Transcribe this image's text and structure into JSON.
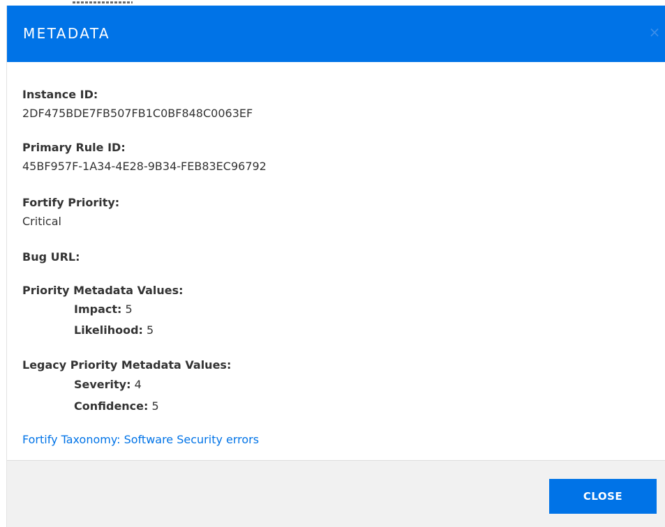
{
  "dialog": {
    "title": "METADATA",
    "close_icon": "close-icon",
    "close_glyph": "×"
  },
  "fields": {
    "instance_id": {
      "label": "Instance ID:",
      "value": "2DF475BDE7FB507FB1C0BF848C0063EF"
    },
    "primary_rule_id": {
      "label": "Primary Rule ID:",
      "value": "45BF957F-1A34-4E28-9B34-FEB83EC96792"
    },
    "fortify_priority": {
      "label": "Fortify Priority:",
      "value": "Critical"
    },
    "bug_url": {
      "label": "Bug URL:",
      "value": ""
    },
    "priority_metadata": {
      "label": "Priority Metadata Values:",
      "items": [
        {
          "label": "Impact:",
          "value": "5"
        },
        {
          "label": "Likelihood:",
          "value": "5"
        }
      ]
    },
    "legacy_priority_metadata": {
      "label": "Legacy Priority Metadata Values:",
      "items": [
        {
          "label": "Severity:",
          "value": "4"
        },
        {
          "label": "Confidence:",
          "value": "5"
        }
      ]
    }
  },
  "taxonomy_link": {
    "text": "Fortify Taxonomy: Software Security errors"
  },
  "footer": {
    "close_label": "CLOSE"
  },
  "colors": {
    "accent": "#0073e7",
    "footer_bg": "#f1f1f1",
    "text": "#333333"
  }
}
